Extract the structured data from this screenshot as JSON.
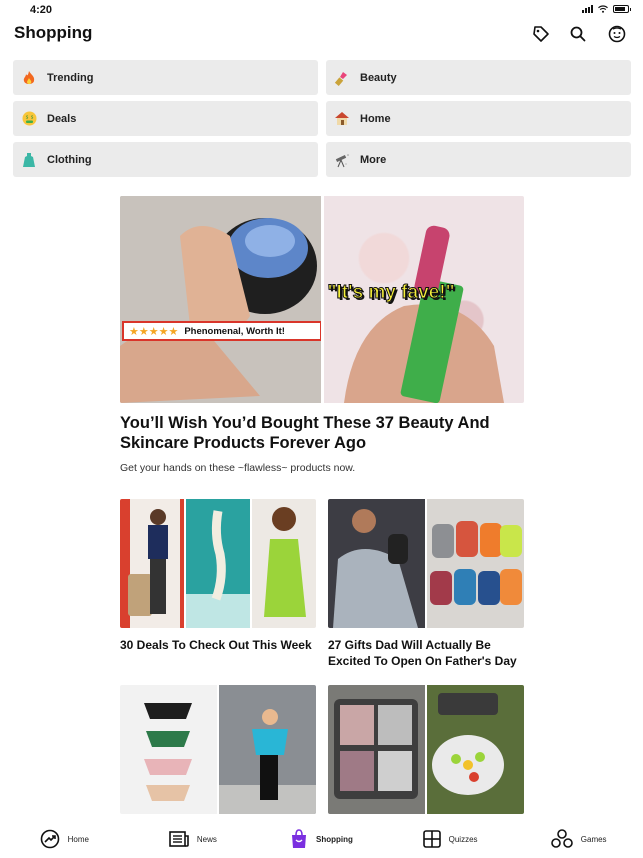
{
  "status_bar": {
    "time": "4:20"
  },
  "header": {
    "title": "Shopping"
  },
  "categories": [
    {
      "label": "Trending",
      "icon": "fire-icon"
    },
    {
      "label": "Beauty",
      "icon": "lipstick-icon"
    },
    {
      "label": "Deals",
      "icon": "money-mouth-face-icon"
    },
    {
      "label": "Home",
      "icon": "house-icon"
    },
    {
      "label": "Clothing",
      "icon": "dress-icon"
    },
    {
      "label": "More",
      "icon": "telescope-icon"
    }
  ],
  "featured": {
    "title": "You’ll Wish You’d Bought These 37 Beauty And Skincare Products Forever Ago",
    "subtitle": "Get your hands on these ~flawless~ products now.",
    "image_left_overlay": {
      "stars": "★★★★★",
      "text": "Phenomenal, Worth It!"
    },
    "image_right_overlay": "\"It's my fave!\""
  },
  "articles": [
    {
      "title": "30 Deals To Check Out This Week"
    },
    {
      "title": "27 Gifts Dad Will Actually Be Excited To Open On Father's Day"
    },
    {
      "title": ""
    },
    {
      "title": ""
    }
  ],
  "tabbar": {
    "items": [
      {
        "label": "Home",
        "icon": "trending-circle-icon"
      },
      {
        "label": "News",
        "icon": "newspaper-icon"
      },
      {
        "label": "Shopping",
        "icon": "shopping-bag-icon",
        "active": true
      },
      {
        "label": "Quizzes",
        "icon": "quiz-grid-icon"
      },
      {
        "label": "Games",
        "icon": "games-circles-icon"
      }
    ]
  },
  "colors": {
    "accent": "#7b2fe0",
    "tile_bg": "#ebebeb",
    "star": "#f5a623",
    "overlay_yellow": "#f6f03b"
  }
}
